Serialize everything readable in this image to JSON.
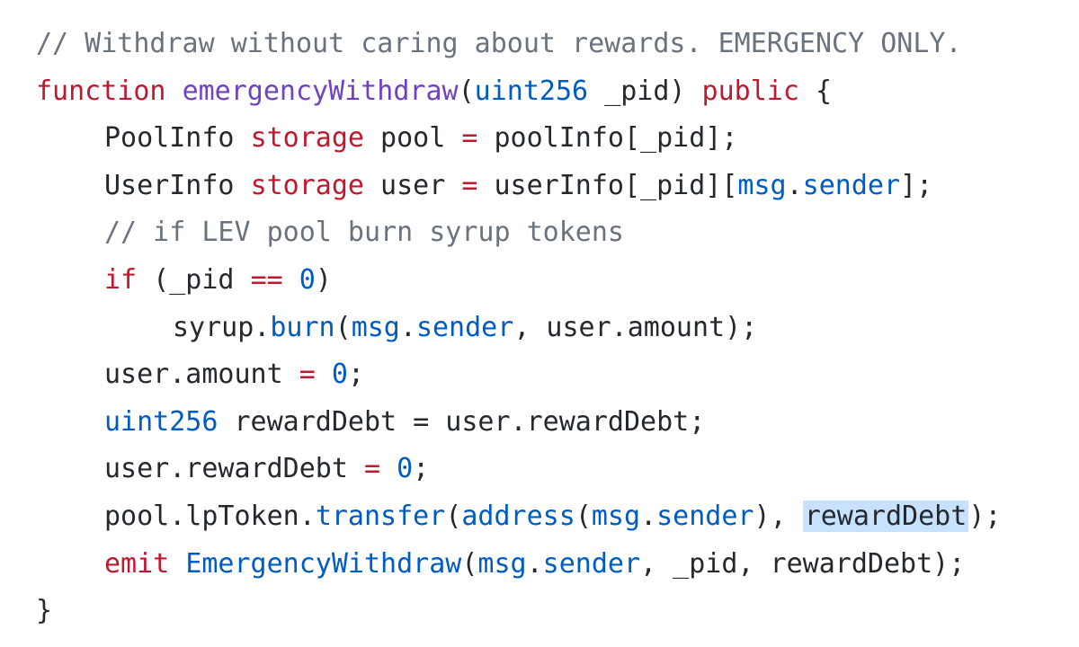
{
  "code": {
    "lines": [
      {
        "indent": 0,
        "tokens": [
          {
            "t": "// Withdraw without caring about rewards. EMERGENCY ONLY.",
            "c": "comment"
          }
        ]
      },
      {
        "indent": 0,
        "tokens": [
          {
            "t": "function",
            "c": "keyword"
          },
          {
            "t": " ",
            "c": "plain"
          },
          {
            "t": "emergencyWithdraw",
            "c": "func"
          },
          {
            "t": "(",
            "c": "plain"
          },
          {
            "t": "uint256",
            "c": "type"
          },
          {
            "t": " _pid) ",
            "c": "plain"
          },
          {
            "t": "public",
            "c": "keyword"
          },
          {
            "t": " {",
            "c": "plain"
          }
        ]
      },
      {
        "indent": 1,
        "tokens": [
          {
            "t": "PoolInfo ",
            "c": "plain"
          },
          {
            "t": "storage",
            "c": "keyword"
          },
          {
            "t": " pool ",
            "c": "plain"
          },
          {
            "t": "=",
            "c": "keyword"
          },
          {
            "t": " poolInfo[_pid];",
            "c": "plain"
          }
        ]
      },
      {
        "indent": 1,
        "tokens": [
          {
            "t": "UserInfo ",
            "c": "plain"
          },
          {
            "t": "storage",
            "c": "keyword"
          },
          {
            "t": " user ",
            "c": "plain"
          },
          {
            "t": "=",
            "c": "keyword"
          },
          {
            "t": " userInfo[_pid][",
            "c": "plain"
          },
          {
            "t": "msg",
            "c": "type"
          },
          {
            "t": ".",
            "c": "plain"
          },
          {
            "t": "sender",
            "c": "prop"
          },
          {
            "t": "];",
            "c": "plain"
          }
        ]
      },
      {
        "indent": 1,
        "tokens": [
          {
            "t": "// if LEV pool burn syrup tokens",
            "c": "comment"
          }
        ]
      },
      {
        "indent": 1,
        "tokens": [
          {
            "t": "if",
            "c": "keyword"
          },
          {
            "t": " (_pid ",
            "c": "plain"
          },
          {
            "t": "==",
            "c": "keyword"
          },
          {
            "t": " ",
            "c": "plain"
          },
          {
            "t": "0",
            "c": "number"
          },
          {
            "t": ")",
            "c": "plain"
          }
        ]
      },
      {
        "indent": 2,
        "tokens": [
          {
            "t": "syrup.",
            "c": "plain"
          },
          {
            "t": "burn",
            "c": "prop"
          },
          {
            "t": "(",
            "c": "plain"
          },
          {
            "t": "msg",
            "c": "type"
          },
          {
            "t": ".",
            "c": "plain"
          },
          {
            "t": "sender",
            "c": "prop"
          },
          {
            "t": ", user.amount);",
            "c": "plain"
          }
        ]
      },
      {
        "indent": 1,
        "tokens": [
          {
            "t": "user.amount ",
            "c": "plain"
          },
          {
            "t": "=",
            "c": "keyword"
          },
          {
            "t": " ",
            "c": "plain"
          },
          {
            "t": "0",
            "c": "number"
          },
          {
            "t": ";",
            "c": "plain"
          }
        ]
      },
      {
        "indent": 1,
        "tokens": [
          {
            "t": "uint256",
            "c": "type"
          },
          {
            "t": " rewardDebt = user.rewardDebt;",
            "c": "plain"
          }
        ]
      },
      {
        "indent": 1,
        "tokens": [
          {
            "t": "user.rewardDebt ",
            "c": "plain"
          },
          {
            "t": "=",
            "c": "keyword"
          },
          {
            "t": " ",
            "c": "plain"
          },
          {
            "t": "0",
            "c": "number"
          },
          {
            "t": ";",
            "c": "plain"
          }
        ]
      },
      {
        "indent": 1,
        "tokens": [
          {
            "t": "pool.lpToken.",
            "c": "plain"
          },
          {
            "t": "transfer",
            "c": "prop"
          },
          {
            "t": "(",
            "c": "plain"
          },
          {
            "t": "address",
            "c": "type"
          },
          {
            "t": "(",
            "c": "plain"
          },
          {
            "t": "msg",
            "c": "type"
          },
          {
            "t": ".",
            "c": "plain"
          },
          {
            "t": "sender",
            "c": "prop"
          },
          {
            "t": "), ",
            "c": "plain"
          },
          {
            "t": "rewardDebt",
            "c": "highlight"
          },
          {
            "t": ");",
            "c": "plain"
          }
        ]
      },
      {
        "indent": 1,
        "tokens": [
          {
            "t": "emit",
            "c": "keyword"
          },
          {
            "t": " ",
            "c": "plain"
          },
          {
            "t": "EmergencyWithdraw",
            "c": "type"
          },
          {
            "t": "(",
            "c": "plain"
          },
          {
            "t": "msg",
            "c": "type"
          },
          {
            "t": ".",
            "c": "plain"
          },
          {
            "t": "sender",
            "c": "prop"
          },
          {
            "t": ", _pid, rewardDebt);",
            "c": "plain"
          }
        ]
      },
      {
        "indent": 0,
        "tokens": [
          {
            "t": "}",
            "c": "plain"
          }
        ]
      }
    ]
  },
  "colors": {
    "comment": "#6a737d",
    "keyword": "#c0192f",
    "function": "#6f42c1",
    "type": "#005cc5",
    "plain": "#24292e",
    "highlight_bg": "#c8e1ff"
  }
}
